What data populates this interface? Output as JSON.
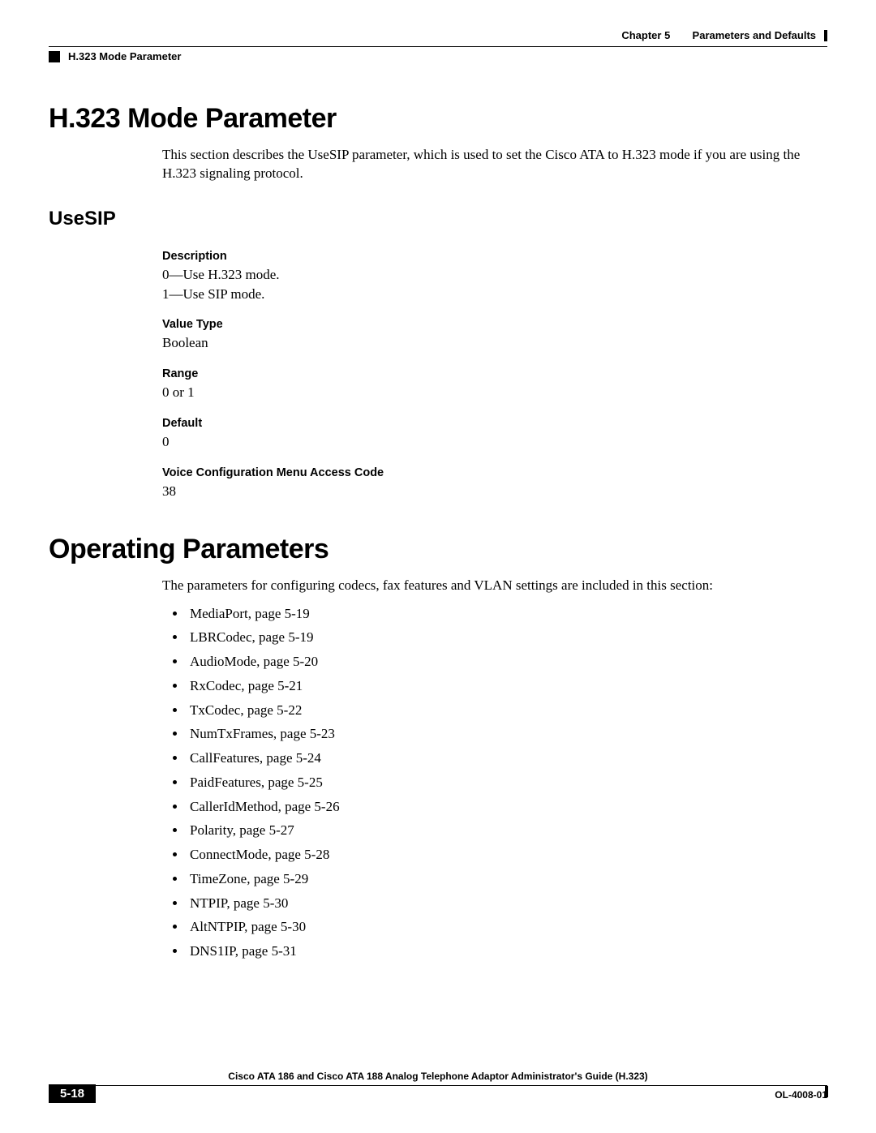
{
  "header": {
    "left_text": "H.323 Mode Parameter",
    "right_chapter": "Chapter 5",
    "right_title": "Parameters and Defaults"
  },
  "section1": {
    "title": "H.323 Mode Parameter",
    "intro": "This section describes the UseSIP parameter, which is used to set the Cisco ATA to H.323 mode if you are using the H.323 signaling protocol.",
    "subsection": "UseSIP",
    "desc_label": "Description",
    "desc_line1": "0—Use H.323 mode.",
    "desc_line2": "1—Use SIP mode.",
    "vt_label": "Value Type",
    "vt_value": "Boolean",
    "range_label": "Range",
    "range_value": "0 or 1",
    "default_label": "Default",
    "default_value": "0",
    "vcm_label": "Voice Configuration Menu Access Code",
    "vcm_value": "38"
  },
  "section2": {
    "title": "Operating Parameters",
    "intro": "The parameters for configuring codecs, fax features and VLAN settings are included in this section:",
    "items": [
      "MediaPort, page 5-19",
      "LBRCodec, page 5-19",
      "AudioMode, page 5-20",
      "RxCodec, page 5-21",
      "TxCodec, page 5-22",
      "NumTxFrames, page 5-23",
      "CallFeatures, page 5-24",
      "PaidFeatures, page 5-25",
      "CallerIdMethod, page 5-26",
      "Polarity, page 5-27",
      "ConnectMode, page 5-28",
      "TimeZone, page 5-29",
      "NTPIP, page 5-30",
      "AltNTPIP, page 5-30",
      "DNS1IP, page 5-31"
    ]
  },
  "footer": {
    "book_title": "Cisco ATA 186 and Cisco ATA 188 Analog Telephone Adaptor Administrator's Guide (H.323)",
    "page_number": "5-18",
    "doc_id": "OL-4008-01"
  }
}
